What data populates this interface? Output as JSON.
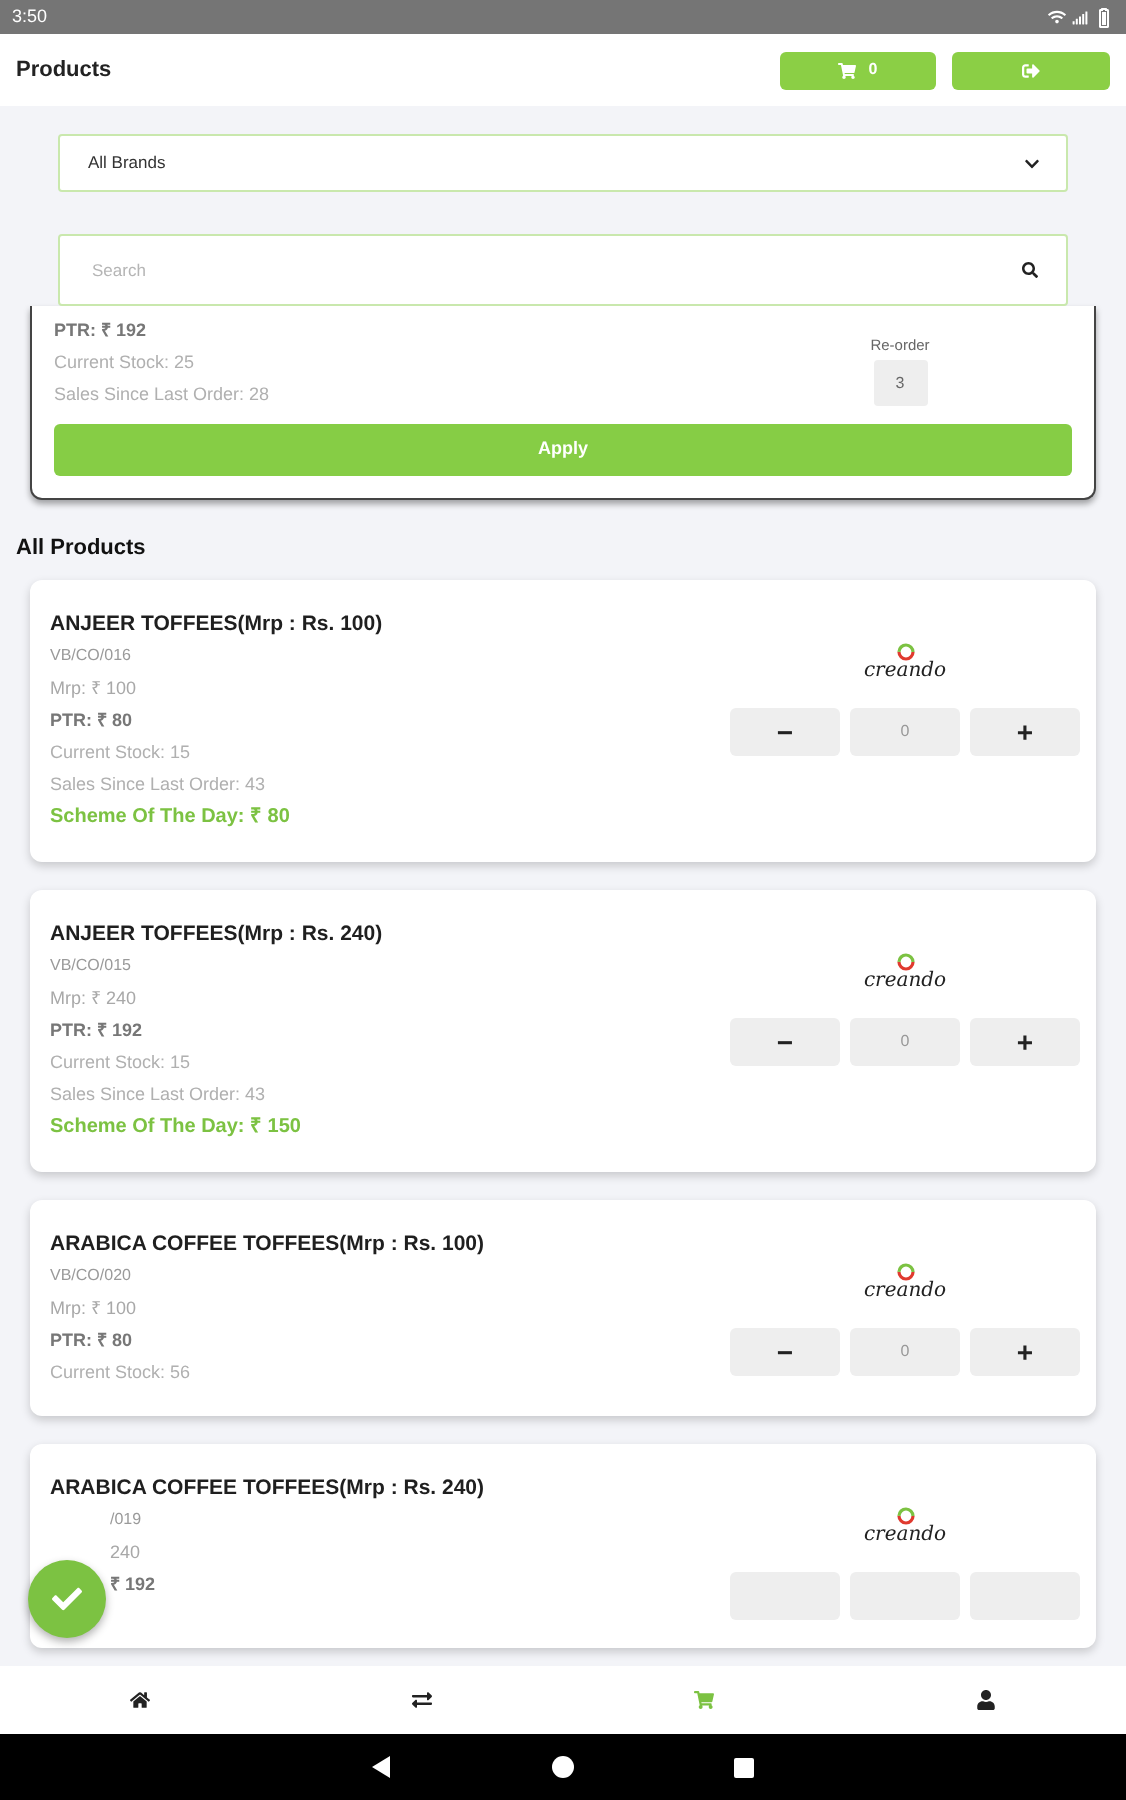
{
  "status_bar": {
    "time": "3:50"
  },
  "header": {
    "title": "Products",
    "cart_count": "0"
  },
  "brand_filter": {
    "value": "All Brands"
  },
  "search": {
    "placeholder": "Search"
  },
  "reorder_card": {
    "lines": [
      {
        "kind": "ptr",
        "text": "PTR:  ₹ 192"
      },
      {
        "kind": "stock",
        "text": "Current Stock: 25"
      },
      {
        "kind": "sales",
        "text": "Sales Since Last Order: 28"
      }
    ],
    "reorder_label": "Re-order",
    "reorder_value": "3",
    "apply": "Apply"
  },
  "section_title": "All Products",
  "products": [
    {
      "name": "ANJEER TOFFEES(Mrp : Rs. 100)",
      "logo": "creando",
      "lines": [
        {
          "kind": "code",
          "text": "VB/CO/016"
        },
        {
          "kind": "mrp",
          "text": "Mrp:  ₹ 100"
        },
        {
          "kind": "ptr",
          "text": "PTR:  ₹ 80"
        },
        {
          "kind": "stock",
          "text": "Current Stock: 15"
        },
        {
          "kind": "sales",
          "text": "Sales Since Last Order:  43"
        },
        {
          "kind": "scheme",
          "text": "Scheme Of The Day:  ₹ 80"
        }
      ],
      "stepper": {
        "minus": "−",
        "qty": "0",
        "plus": "+"
      }
    },
    {
      "name": "ANJEER TOFFEES(Mrp : Rs. 240)",
      "logo": "creando",
      "lines": [
        {
          "kind": "code",
          "text": "VB/CO/015"
        },
        {
          "kind": "mrp",
          "text": "Mrp:  ₹ 240"
        },
        {
          "kind": "ptr",
          "text": "PTR:  ₹ 192"
        },
        {
          "kind": "stock",
          "text": "Current Stock: 15"
        },
        {
          "kind": "sales",
          "text": "Sales Since Last Order:  43"
        },
        {
          "kind": "scheme",
          "text": "Scheme Of The Day:  ₹ 150"
        }
      ],
      "stepper": {
        "minus": "−",
        "qty": "0",
        "plus": "+"
      }
    },
    {
      "name": "ARABICA  COFFEE TOFFEES(Mrp : Rs. 100)",
      "logo": "creando",
      "lines": [
        {
          "kind": "code",
          "text": "VB/CO/020"
        },
        {
          "kind": "mrp",
          "text": "Mrp:  ₹ 100"
        },
        {
          "kind": "ptr",
          "text": "PTR:  ₹ 80"
        },
        {
          "kind": "stock",
          "text": "Current Stock: 56"
        }
      ],
      "stepper": {
        "minus": "−",
        "qty": "0",
        "plus": "+"
      }
    },
    {
      "name": "ARABICA  COFFEE TOFFEES(Mrp : Rs. 240)",
      "logo": "creando",
      "lines": [
        {
          "kind": "code_cut",
          "text": "/019"
        },
        {
          "kind": "mrp_cut",
          "text": "240"
        },
        {
          "kind": "ptr_cut",
          "text": "₹ 192"
        }
      ],
      "kind": "cut"
    }
  ],
  "bottom_nav": [
    {
      "selected": false
    },
    {
      "selected": false
    },
    {
      "selected": true
    },
    {
      "selected": false
    }
  ]
}
